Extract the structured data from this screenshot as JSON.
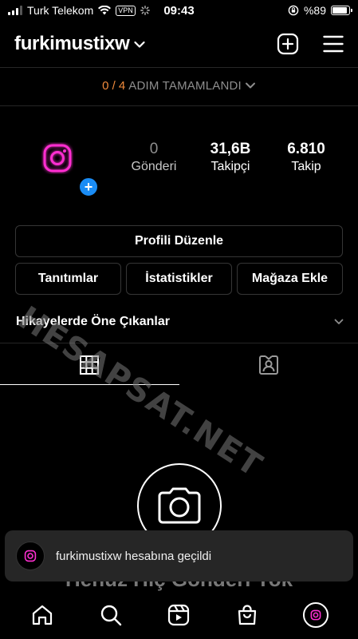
{
  "status_bar": {
    "carrier": "Turk Telekom",
    "vpn": "VPN",
    "time": "09:43",
    "battery": "%89",
    "battery_level": 0.89
  },
  "header": {
    "username": "furkimustixw"
  },
  "steps": {
    "count": "0 / 4",
    "label": "ADIM TAMAMLANDI"
  },
  "profile": {
    "stats": [
      {
        "value": "0",
        "label": "Gönderi"
      },
      {
        "value": "31,6B",
        "label": "Takipçi"
      },
      {
        "value": "6.810",
        "label": "Takip"
      }
    ]
  },
  "buttons": {
    "edit_profile": "Profili Düzenle",
    "promotions": "Tanıtımlar",
    "insights": "İstatistikler",
    "add_shop": "Mağaza Ekle"
  },
  "highlights": {
    "label": "Hikayelerde Öne Çıkanlar"
  },
  "empty_state": {
    "title": "Henüz Hiç Gönderi Yok"
  },
  "watermark": "HESAPSAT.NET",
  "toast": {
    "message": "furkimustixw hesabına geçildi"
  },
  "colors": {
    "accent_orange": "#f08a3c",
    "badge_blue": "#1a8cf5",
    "logo_pink": "#ff2fd1"
  }
}
